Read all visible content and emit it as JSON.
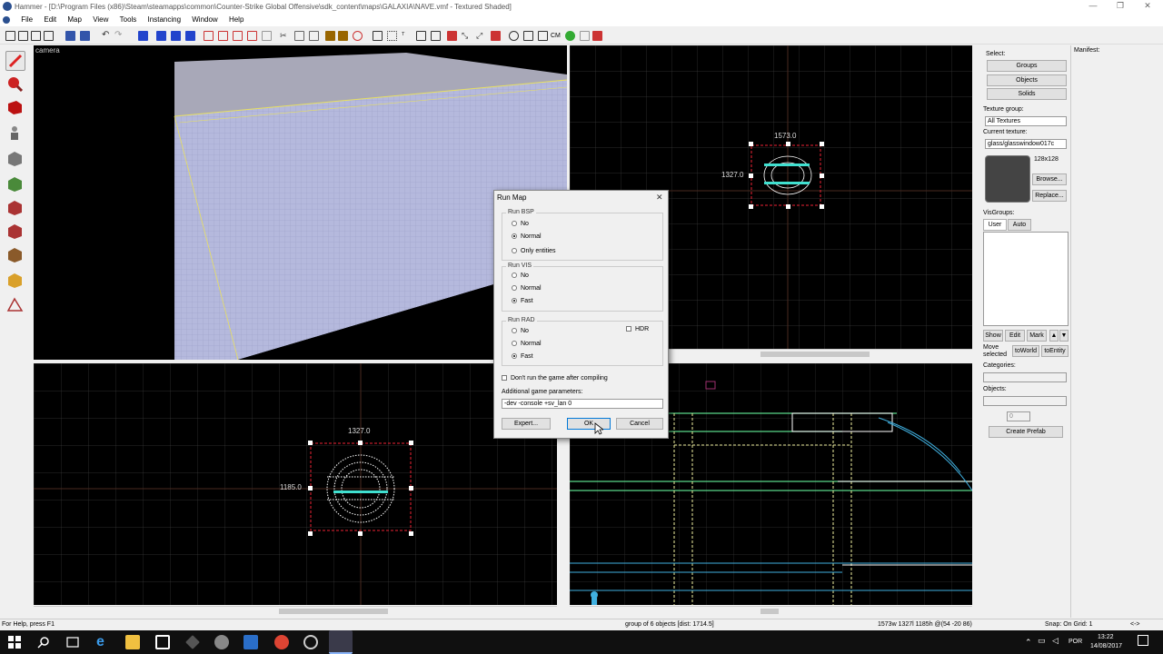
{
  "window": {
    "title": "Hammer - [D:\\Program Files (x86)\\Steam\\steamapps\\common\\Counter-Strike Global Offensive\\sdk_content\\maps\\GALAXIA\\NAVE.vmf - Textured Shaded]",
    "minimize": "—",
    "maximize": "❐",
    "close": "✕"
  },
  "menu": [
    "File",
    "Edit",
    "Map",
    "View",
    "Tools",
    "Instancing",
    "Window",
    "Help"
  ],
  "viewports": {
    "camera_label": "camera",
    "top_right": {
      "width_label": "1573.0",
      "height_label": "1327.0"
    },
    "bottom_left": {
      "width_label": "1327.0",
      "height_label": "1185.0"
    }
  },
  "right_panel": {
    "select_label": "Select:",
    "groups": "Groups",
    "objects": "Objects",
    "solids": "Solids",
    "texture_group_label": "Texture group:",
    "texture_group_value": "All Textures",
    "current_texture_label": "Current texture:",
    "current_texture_value": "glass/glasswindow017c",
    "texture_size": "128x128",
    "browse": "Browse...",
    "replace": "Replace...",
    "visgroups_label": "VisGroups:",
    "tab_user": "User",
    "tab_auto": "Auto",
    "show": "Show",
    "edit": "Edit",
    "mark": "Mark",
    "move_selected": "Move selected",
    "to_world": "toWorld",
    "to_entity": "toEntity",
    "categories_label": "Categories:",
    "objects_label": "Objects:",
    "spinner_value": "0",
    "create_prefab": "Create Prefab",
    "manifest_label": "Manifest:"
  },
  "dialog": {
    "title": "Run Map",
    "close": "✕",
    "run_bsp": {
      "label": "Run BSP",
      "options": [
        "No",
        "Normal",
        "Only entities"
      ],
      "selected": "Normal"
    },
    "run_vis": {
      "label": "Run VIS",
      "options": [
        "No",
        "Normal",
        "Fast"
      ],
      "selected": "Fast"
    },
    "run_rad": {
      "label": "Run RAD",
      "options": [
        "No",
        "Normal",
        "Fast"
      ],
      "selected": "Fast",
      "hdr_label": "HDR"
    },
    "dont_run_label": "Don't run the game after compiling",
    "additional_params_label": "Additional game parameters:",
    "additional_params_value": "-dev -console +sv_lan 0",
    "expert": "Expert...",
    "ok": "OK",
    "cancel": "Cancel"
  },
  "status": {
    "help": "For Help, press F1",
    "selection": "group of 6 objects  [dist: 1714.5]",
    "dims": "1573w 1327l 1185h @(54 -20 86)",
    "snap": "Snap: On Grid: 1",
    "arrows": "<->"
  },
  "taskbar": {
    "lang": "POR",
    "time": "13:22",
    "date": "14/08/2017"
  }
}
